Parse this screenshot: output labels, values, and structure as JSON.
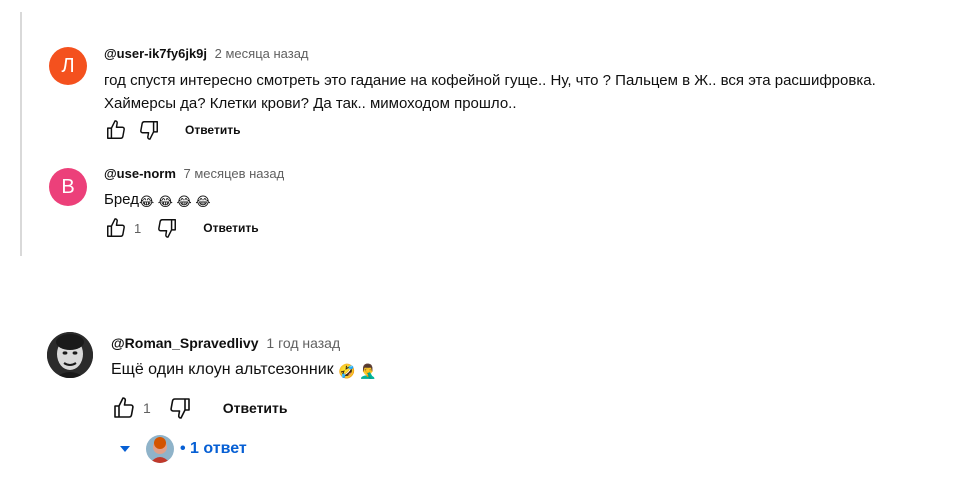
{
  "comments": [
    {
      "avatar_letter": "Л",
      "avatar_color": "#f4511e",
      "author": "@user-ik7fy6jk9j",
      "time": "2 месяца назад",
      "text": "год спустя интересно смотреть это гадание на кофейной гуще.. Ну, что ? Пальцем в Ж..  вся эта расшифровка.  Хаймерсы да? Клетки крови? Да так.. мимоходом прошло..",
      "likes": "",
      "reply_label": "Ответить"
    },
    {
      "avatar_letter": "В",
      "avatar_color": "#ec407a",
      "author": "@use-norm",
      "time": "7 месяцев назад",
      "text": "Бред",
      "emojis": "😂 😂 😂 😂",
      "likes": "1",
      "reply_label": "Ответить"
    },
    {
      "author": "@Roman_Spravedlivy",
      "time": "1 год назад",
      "text": "Ещё один клоун альтсезонник",
      "emojis": "🤣 🤦‍♂️",
      "likes": "1",
      "reply_label": "Ответить"
    }
  ],
  "replies_toggle": {
    "label": "• 1 ответ"
  },
  "colors": {
    "link_blue": "#065fd4",
    "thread_line": "#d9d9d9"
  },
  "icons": [
    "like-icon",
    "dislike-icon",
    "chevron-down-icon"
  ]
}
